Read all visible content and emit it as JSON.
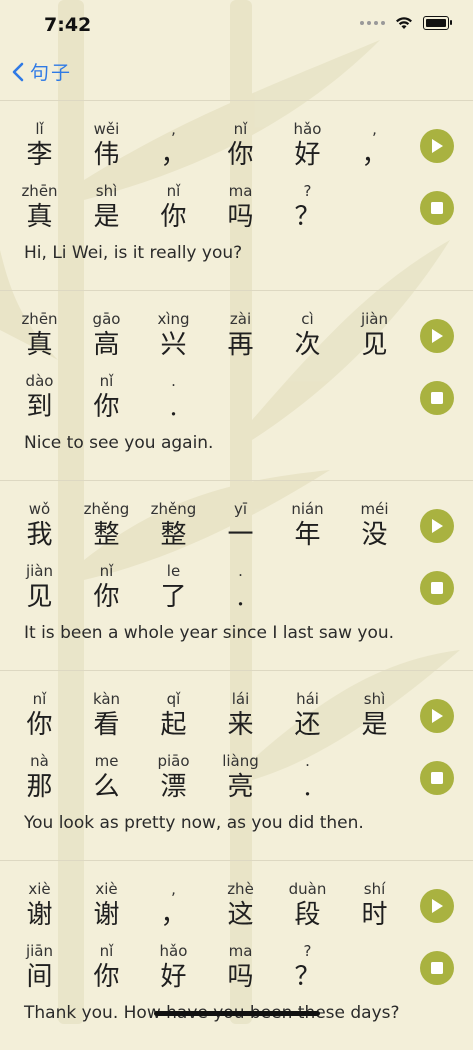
{
  "status_bar": {
    "time": "7:42"
  },
  "nav": {
    "back_label": "句子"
  },
  "colors": {
    "accent": "#2f7ae5",
    "button": "#a9b240",
    "background": "#f3efd9"
  },
  "icons": {
    "back": "chevron-left-icon",
    "play": "play-icon",
    "stop": "stop-icon",
    "wifi": "wifi-icon",
    "battery": "battery-icon"
  },
  "sentences": [
    {
      "line1": [
        {
          "py": "lǐ",
          "hz": "李"
        },
        {
          "py": "wěi",
          "hz": "伟"
        },
        {
          "py": ",",
          "hz": "，"
        },
        {
          "py": "nǐ",
          "hz": "你"
        },
        {
          "py": "hǎo",
          "hz": "好"
        },
        {
          "py": ",",
          "hz": "，"
        }
      ],
      "line2": [
        {
          "py": "zhēn",
          "hz": "真"
        },
        {
          "py": "shì",
          "hz": "是"
        },
        {
          "py": "nǐ",
          "hz": "你"
        },
        {
          "py": "ma",
          "hz": "吗"
        },
        {
          "py": "?",
          "hz": "？"
        }
      ],
      "translation": "Hi, Li Wei, is it really you?"
    },
    {
      "line1": [
        {
          "py": "zhēn",
          "hz": "真"
        },
        {
          "py": "gāo",
          "hz": "高"
        },
        {
          "py": "xìng",
          "hz": "兴"
        },
        {
          "py": "zài",
          "hz": "再"
        },
        {
          "py": "cì",
          "hz": "次"
        },
        {
          "py": "jiàn",
          "hz": "见"
        }
      ],
      "line2": [
        {
          "py": "dào",
          "hz": "到"
        },
        {
          "py": "nǐ",
          "hz": "你"
        },
        {
          "py": ".",
          "hz": "."
        }
      ],
      "translation": "Nice to see you again."
    },
    {
      "line1": [
        {
          "py": "wǒ",
          "hz": "我"
        },
        {
          "py": "zhěng",
          "hz": "整"
        },
        {
          "py": "zhěng",
          "hz": "整"
        },
        {
          "py": "yī",
          "hz": "一"
        },
        {
          "py": "nián",
          "hz": "年"
        },
        {
          "py": "méi",
          "hz": "没"
        }
      ],
      "line2": [
        {
          "py": "jiàn",
          "hz": "见"
        },
        {
          "py": "nǐ",
          "hz": "你"
        },
        {
          "py": "le",
          "hz": "了"
        },
        {
          "py": ".",
          "hz": "."
        }
      ],
      "translation": "It is been a whole year since I last saw you."
    },
    {
      "line1": [
        {
          "py": "nǐ",
          "hz": "你"
        },
        {
          "py": "kàn",
          "hz": "看"
        },
        {
          "py": "qǐ",
          "hz": "起"
        },
        {
          "py": "lái",
          "hz": "来"
        },
        {
          "py": "hái",
          "hz": "还"
        },
        {
          "py": "shì",
          "hz": "是"
        }
      ],
      "line2": [
        {
          "py": "nà",
          "hz": "那"
        },
        {
          "py": "me",
          "hz": "么"
        },
        {
          "py": "piāo",
          "hz": "漂"
        },
        {
          "py": "liàng",
          "hz": "亮"
        },
        {
          "py": ".",
          "hz": "."
        }
      ],
      "translation": "You look as pretty now, as you did then."
    },
    {
      "line1": [
        {
          "py": "xiè",
          "hz": "谢"
        },
        {
          "py": "xiè",
          "hz": "谢"
        },
        {
          "py": ",",
          "hz": "，"
        },
        {
          "py": "zhè",
          "hz": "这"
        },
        {
          "py": "duàn",
          "hz": "段"
        },
        {
          "py": "shí",
          "hz": "时"
        }
      ],
      "line2": [
        {
          "py": "jiān",
          "hz": "间"
        },
        {
          "py": "nǐ",
          "hz": "你"
        },
        {
          "py": "hǎo",
          "hz": "好"
        },
        {
          "py": "ma",
          "hz": "吗"
        },
        {
          "py": "?",
          "hz": "？"
        }
      ],
      "translation": "Thank you. How have you been these days?"
    }
  ]
}
